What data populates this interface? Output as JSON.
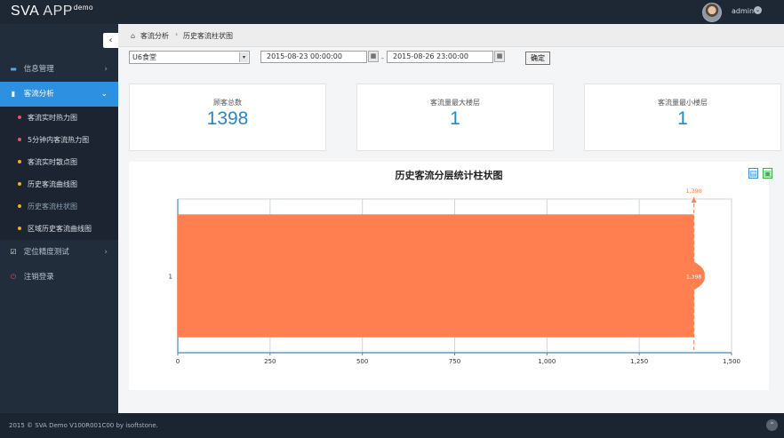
{
  "app": {
    "brand": "SVA",
    "brand_app": "APP",
    "brand_sup": "demo"
  },
  "user": {
    "name": "admin",
    "caret": "⌄"
  },
  "sidebar": {
    "collapse_icon": "‹",
    "items": [
      {
        "label": "信息管理",
        "icon": "folder-icon",
        "glyph": "▬",
        "chev": "›"
      },
      {
        "label": "客流分析",
        "icon": "bar-chart-icon",
        "glyph": "▮",
        "chev": "⌄"
      },
      {
        "label": "定位精度测试",
        "icon": "edit-check-icon",
        "glyph": "☑",
        "chev": "›"
      },
      {
        "label": "注销登录",
        "icon": "power-icon",
        "glyph": "⏻"
      }
    ],
    "subitems": [
      {
        "label": "客流实时热力图",
        "dot": "#e8516a"
      },
      {
        "label": "5分钟内客流热力图",
        "dot": "#e8516a"
      },
      {
        "label": "客流实时散点图",
        "dot": "#f2b01e"
      },
      {
        "label": "历史客流曲线图",
        "dot": "#f2b01e"
      },
      {
        "label": "历史客流柱状图",
        "dot": "#f2b01e"
      },
      {
        "label": "区域历史客流曲线图",
        "dot": "#f2b01e"
      }
    ]
  },
  "breadcrumb": {
    "home": "⌂",
    "item1": "客流分析",
    "sep": "›",
    "item2": "历史客流柱状图"
  },
  "filter": {
    "venue": "U6食堂",
    "arrow": "▾",
    "start": "2015-08-23 00:00:00",
    "end": "2015-08-26 23:00:00",
    "dash": "-",
    "cal": "▦",
    "confirm": "确定"
  },
  "cards": [
    {
      "label": "顾客总数",
      "value": "1398"
    },
    {
      "label": "客流量最大楼层",
      "value": "1"
    },
    {
      "label": "客流量最小楼层",
      "value": "1"
    }
  ],
  "toolbar": {
    "data_view_glyph": "▤",
    "save_glyph": "▣"
  },
  "chart_data": {
    "type": "bar",
    "orientation": "horizontal",
    "title": "历史客流分层统计柱状图",
    "categories": [
      "1"
    ],
    "values": [
      1398
    ],
    "xlim": [
      0,
      1500
    ],
    "xticks": [
      0,
      250,
      500,
      750,
      1000,
      1250,
      1500
    ],
    "xtick_labels": [
      "0",
      "250",
      "500",
      "750",
      "1,000",
      "1,250",
      "1,500"
    ],
    "markline_label": "1,398",
    "data_label": "1,398",
    "bar_color": "#ff7f50",
    "grid": true
  },
  "footer": {
    "copyright": "2015 © SVA Demo V100R001C00 by isoftstone.",
    "top_glyph": "⌃"
  },
  "colors": {
    "accent": "#2d90e0",
    "card_value": "#2a86c8",
    "sidebar_bg": "#222d3b"
  }
}
